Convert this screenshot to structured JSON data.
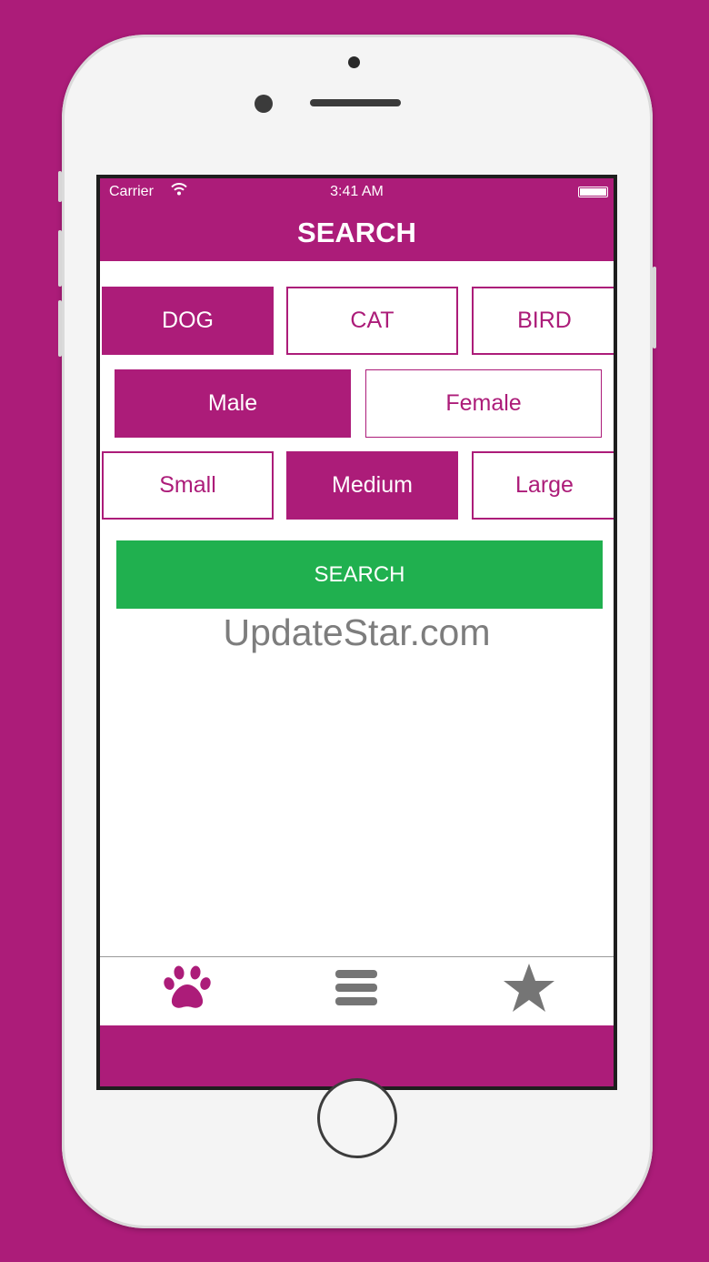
{
  "status_bar": {
    "carrier": "Carrier",
    "time": "3:41 AM"
  },
  "nav": {
    "title": "SEARCH"
  },
  "filters": {
    "species": [
      {
        "label": "DOG",
        "selected": true
      },
      {
        "label": "CAT",
        "selected": false
      },
      {
        "label": "BIRD",
        "selected": false
      }
    ],
    "gender": [
      {
        "label": "Male",
        "selected": true
      },
      {
        "label": "Female",
        "selected": false
      }
    ],
    "size": [
      {
        "label": "Small",
        "selected": false
      },
      {
        "label": "Medium",
        "selected": true
      },
      {
        "label": "Large",
        "selected": false
      }
    ]
  },
  "search_button": {
    "label": "SEARCH"
  },
  "watermark": "UpdateStar.com",
  "tabs": [
    {
      "icon": "paw-icon",
      "active": true
    },
    {
      "icon": "menu-icon",
      "active": false
    },
    {
      "icon": "star-icon",
      "active": false
    }
  ],
  "colors": {
    "brand": "#ac1c79",
    "search": "#20b04f",
    "tab_inactive": "#757575"
  }
}
